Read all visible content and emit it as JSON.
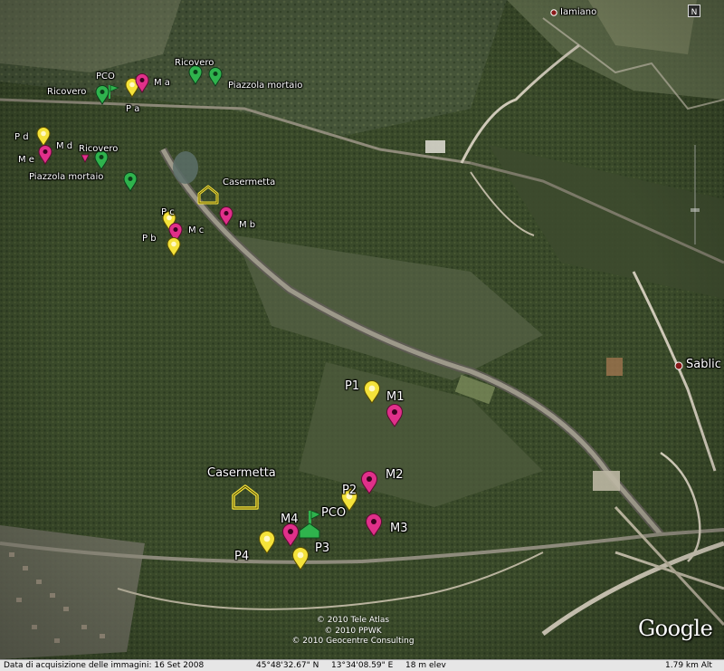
{
  "places": {
    "iamiano": "Iamiano",
    "sablici": "Sablic"
  },
  "markers": {
    "upper": {
      "pco": "PCO",
      "ricovero_1": "Ricovero",
      "ricovero_2": "Ricovero",
      "ricovero_3": "Ricovero",
      "m_a": "M a",
      "p_a": "P a",
      "piazzola_1": "Piazzola mortaio",
      "piazzola_2": "Piazzola mortaio",
      "p_d": "P d",
      "m_d": "M d",
      "m_e": "M e",
      "casermetta": "Casermetta",
      "p_c": "P c",
      "m_c": "M c",
      "p_b": "P b",
      "m_b": "M b"
    },
    "lower": {
      "p1": "P1",
      "m1": "M1",
      "casermetta": "Casermetta",
      "m2": "M2",
      "p2": "P2",
      "pco": "PCO",
      "m4": "M4",
      "m3": "M3",
      "p4": "P4",
      "p3": "P3"
    }
  },
  "overlay": {
    "copyright_lines": [
      "© 2010 Tele Atlas",
      "© 2010 PPWK",
      "© 2010 Geocentre Consulting"
    ],
    "google_logo": "Google",
    "compass_letter": "N"
  },
  "status_bar": {
    "imagery_date": "Data di acquisizione delle immagini: 16 Set 2008",
    "latitude": "45°48'32.67\" N",
    "longitude": "13°34'08.59\" E",
    "elevation": "18 m elev",
    "eye_altitude": "1.79 km Alt"
  },
  "colors": {
    "pin_yellow": "#f4e23a",
    "pin_magenta": "#e0308a",
    "pin_green": "#2fb34d",
    "house": "#f4e23a",
    "place_dot": "#8a1a1a"
  }
}
